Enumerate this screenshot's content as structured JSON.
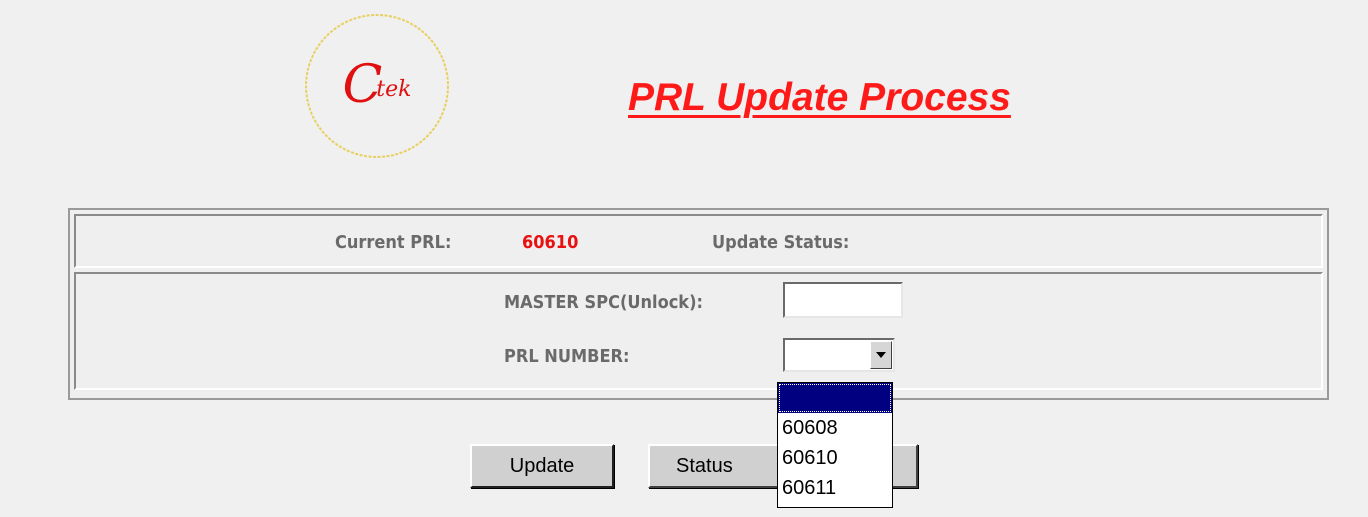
{
  "logo": {
    "text_big": "C",
    "text_small": "tek"
  },
  "header": {
    "title": "PRL Update Process"
  },
  "status_row": {
    "current_prl_label": "Current PRL:",
    "current_prl_value": "60610",
    "update_status_label": "Update Status:"
  },
  "form": {
    "master_spc_label": "MASTER SPC(Unlock):",
    "master_spc_value": "",
    "prl_number_label": "PRL NUMBER:",
    "prl_number_selected": "",
    "prl_options": [
      "",
      "60608",
      "60610",
      "60611"
    ]
  },
  "buttons": {
    "update_label": "Update",
    "status_label": "Status"
  },
  "colors": {
    "title": "#ff1a1a",
    "prl_value": "#e81010",
    "label_gray": "#6a6a6a",
    "selection": "#000080",
    "logo_ring": "#e8d060"
  }
}
